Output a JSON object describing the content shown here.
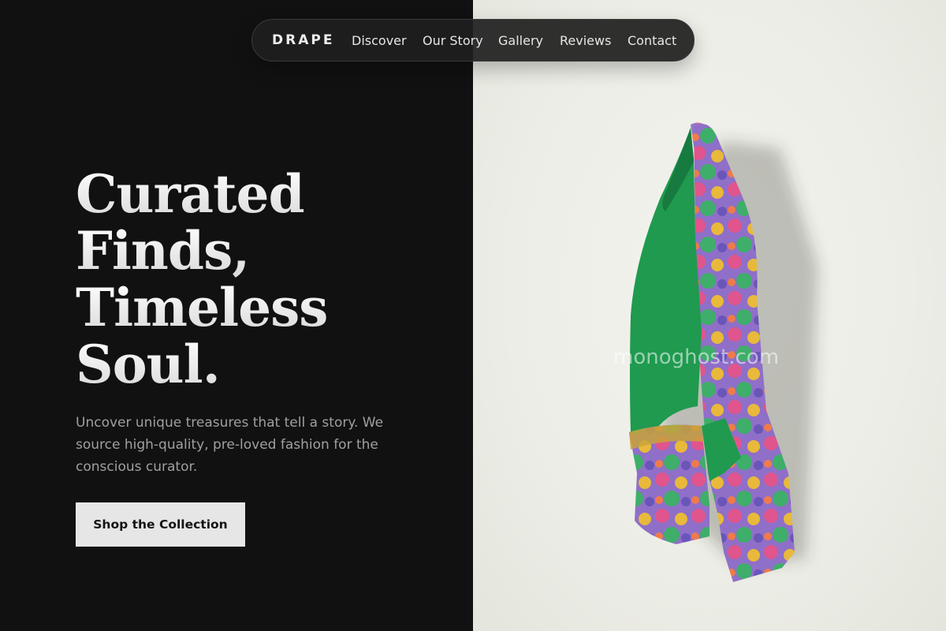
{
  "nav": {
    "brand": "DRAPE",
    "links": [
      "Discover",
      "Our Story",
      "Gallery",
      "Reviews",
      "Contact"
    ]
  },
  "hero": {
    "headline_lines": [
      "Curated",
      "Finds,",
      "Timeless",
      "Soul."
    ],
    "subtitle": "Uncover unique treasures that tell a story. We source high-quality, pre-loved fashion for the conscious curator.",
    "cta_label": "Shop the Collection"
  },
  "image": {
    "watermark": "monoghost.com",
    "subject": "jacket-photo"
  },
  "colors": {
    "background_dark": "#111111",
    "background_light": "#eceee6",
    "jacket_green": "#1f9a4f",
    "cta_bg": "#e6e6e6"
  }
}
